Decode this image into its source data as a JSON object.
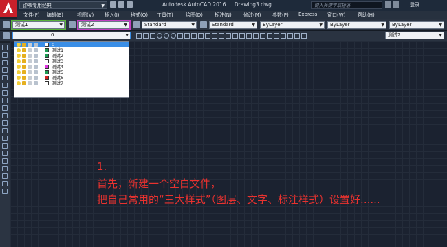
{
  "window": {
    "app_title": "Autodesk AutoCAD 2016",
    "doc_name": "Drawing3.dwg",
    "workspace": "钟爷专用经典",
    "search_placeholder": "键入关键字或短语",
    "login": "登录"
  },
  "menu": [
    "文件(F)",
    "编辑(E)",
    "视图(V)",
    "插入(I)",
    "格式(O)",
    "工具(T)",
    "绘图(D)",
    "标注(N)",
    "修改(M)",
    "参数(P)",
    "Express",
    "窗口(W)",
    "帮助(H)"
  ],
  "toolbar1": {
    "text_style": "测试1",
    "dim_style": "测试2",
    "table_style": "Standard",
    "multileader_style": "Standard",
    "color": "ByLayer",
    "linetype": "ByLayer",
    "lineweight": "ByLayer"
  },
  "toolbar2": {
    "layer_current": "0",
    "dimstyle_right": "测试2"
  },
  "layers": [
    {
      "name": "0",
      "color": "#ffffff",
      "selected": true
    },
    {
      "name": "测试1",
      "color": "#1f9d55",
      "selected": false
    },
    {
      "name": "测试2",
      "color": "#1f9d55",
      "selected": false
    },
    {
      "name": "测试3",
      "color": "#ffffff",
      "selected": false
    },
    {
      "name": "测试4",
      "color": "#e034e0",
      "selected": false
    },
    {
      "name": "测试5",
      "color": "#1f9d55",
      "selected": false
    },
    {
      "name": "测试6",
      "color": "#d42020",
      "selected": false
    },
    {
      "name": "测试7",
      "color": "#ffffff",
      "selected": false
    }
  ],
  "annotation": {
    "line1": "1.",
    "line2": "首先，新建一个空白文件，",
    "line3": "把自己常用的“三大样式”（图层、文字、标注样式）设置好......"
  },
  "colors": {
    "background": "#1c222b",
    "annotation_red": "#e8322f",
    "highlight_green": "#59b43a",
    "highlight_pink": "#c23fc2"
  }
}
